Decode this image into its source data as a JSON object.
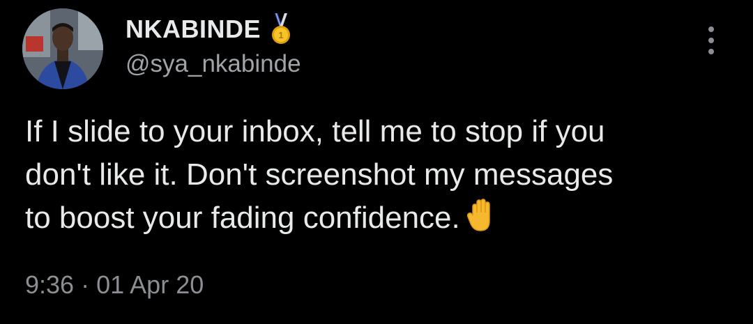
{
  "author": {
    "display_name": "NKABINDE",
    "handle": "@sya_nkabinde",
    "badge_icon": "gold-medal-icon"
  },
  "tweet": {
    "lines": [
      "If I slide to your inbox, tell me to stop if you",
      "don't like it. Don't screenshot my messages",
      "to boost your fading confidence."
    ],
    "emoji_icon": "raised-hand-icon",
    "time": "9:36",
    "separator": "·",
    "date": "01 Apr 20"
  },
  "menu": {
    "icon": "more-vertical-icon"
  },
  "colors": {
    "background": "#000000",
    "text": "#e7e9ea",
    "secondary": "#8b8f94",
    "medal_gold": "#f2b20f",
    "medal_ribbon": "#3b5bc7"
  }
}
